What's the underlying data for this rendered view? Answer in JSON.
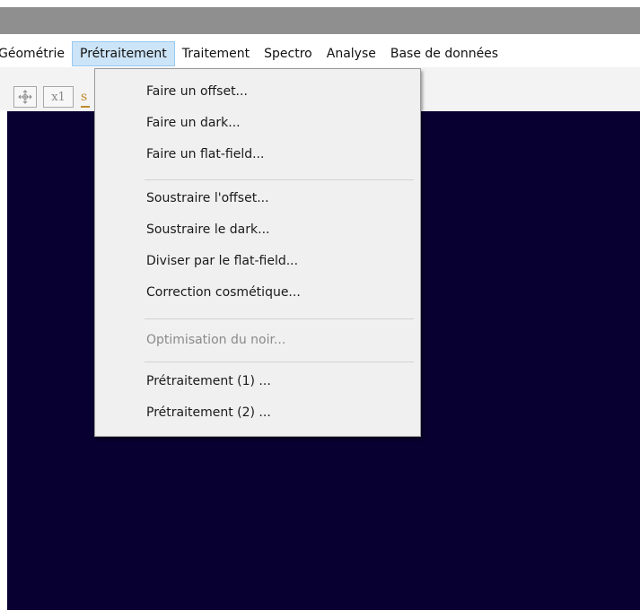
{
  "menubar": {
    "items": [
      {
        "label": "Géométrie"
      },
      {
        "label": "Prétraitement"
      },
      {
        "label": "Traitement"
      },
      {
        "label": "Spectro"
      },
      {
        "label": "Analyse"
      },
      {
        "label": "Base de données"
      }
    ]
  },
  "toolbar": {
    "move_icon": "move-arrows-icon",
    "zoom_label": "x1"
  },
  "dropdown": {
    "groups": [
      {
        "items": [
          {
            "label": "Faire un offset...",
            "enabled": true
          },
          {
            "label": "Faire un dark...",
            "enabled": true
          },
          {
            "label": "Faire un flat-field...",
            "enabled": true
          }
        ]
      },
      {
        "items": [
          {
            "label": "Soustraire l'offset...",
            "enabled": true
          },
          {
            "label": "Soustraire le dark...",
            "enabled": true
          },
          {
            "label": "Diviser par le flat-field...",
            "enabled": true
          },
          {
            "label": "Correction cosmétique...",
            "enabled": true
          }
        ]
      },
      {
        "items": [
          {
            "label": "Optimisation du noir...",
            "enabled": false
          }
        ]
      },
      {
        "items": [
          {
            "label": "Prétraitement (1) ...",
            "enabled": true
          },
          {
            "label": "Prétraitement (2) ...",
            "enabled": true
          }
        ]
      }
    ]
  },
  "colors": {
    "canvas": "#080030",
    "menu_highlight": "#cce4f7",
    "title_strip": "#8f8f8f"
  }
}
